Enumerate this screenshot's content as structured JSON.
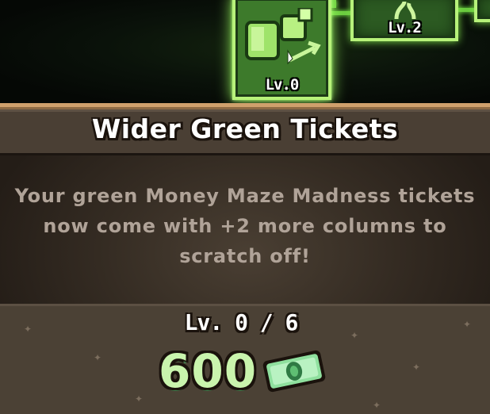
{
  "upgrade_tree": {
    "selected_node": {
      "level_label": "Lv.0",
      "icon": "green-ticket-arrow-icon"
    },
    "next_node": {
      "level_label": "Lv.2",
      "icon": "green-plant-icon"
    }
  },
  "upgrade": {
    "title": "Wider Green Tickets",
    "description": "Your green Money Maze Madness tickets\nnow come with +2 more columns to\nscratch off!",
    "level_progress": "Lv. 0 / 6",
    "current_level": 0,
    "max_level": 6,
    "cost": "600",
    "currency_icon": "green-cash-bill-icon"
  },
  "colors": {
    "panel_background": "#262019",
    "panel_border": "#cfa06c",
    "node_glow": "#9cff5f",
    "cost_text": "#c9f4ad",
    "description_text": "#b0a398"
  }
}
